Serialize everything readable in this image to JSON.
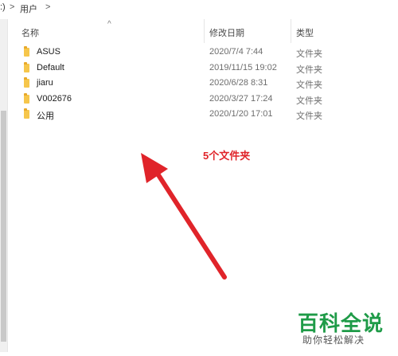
{
  "breadcrumb": {
    "fragment": ":)",
    "separator": ">",
    "segment": "用户"
  },
  "columns": {
    "name": "名称",
    "date": "修改日期",
    "type": "类型",
    "sort_indicator": "^"
  },
  "files": [
    {
      "name": "ASUS",
      "date": "2020/7/4 7:44",
      "type": "文件夹"
    },
    {
      "name": "Default",
      "date": "2019/11/15 19:02",
      "type": "文件夹"
    },
    {
      "name": "jiaru",
      "date": "2020/6/28 8:31",
      "type": "文件夹"
    },
    {
      "name": "V002676",
      "date": "2020/3/27 17:24",
      "type": "文件夹"
    },
    {
      "name": "公用",
      "date": "2020/1/20 17:01",
      "type": "文件夹"
    }
  ],
  "annotation": {
    "text": "5个文件夹",
    "color": "#e0242a"
  },
  "watermark": {
    "title": "百科全说",
    "subtitle": "助你轻松解决",
    "color": "#1f9b48"
  },
  "icons": {
    "folder": "folder-icon",
    "arrow": "annotation-arrow"
  }
}
